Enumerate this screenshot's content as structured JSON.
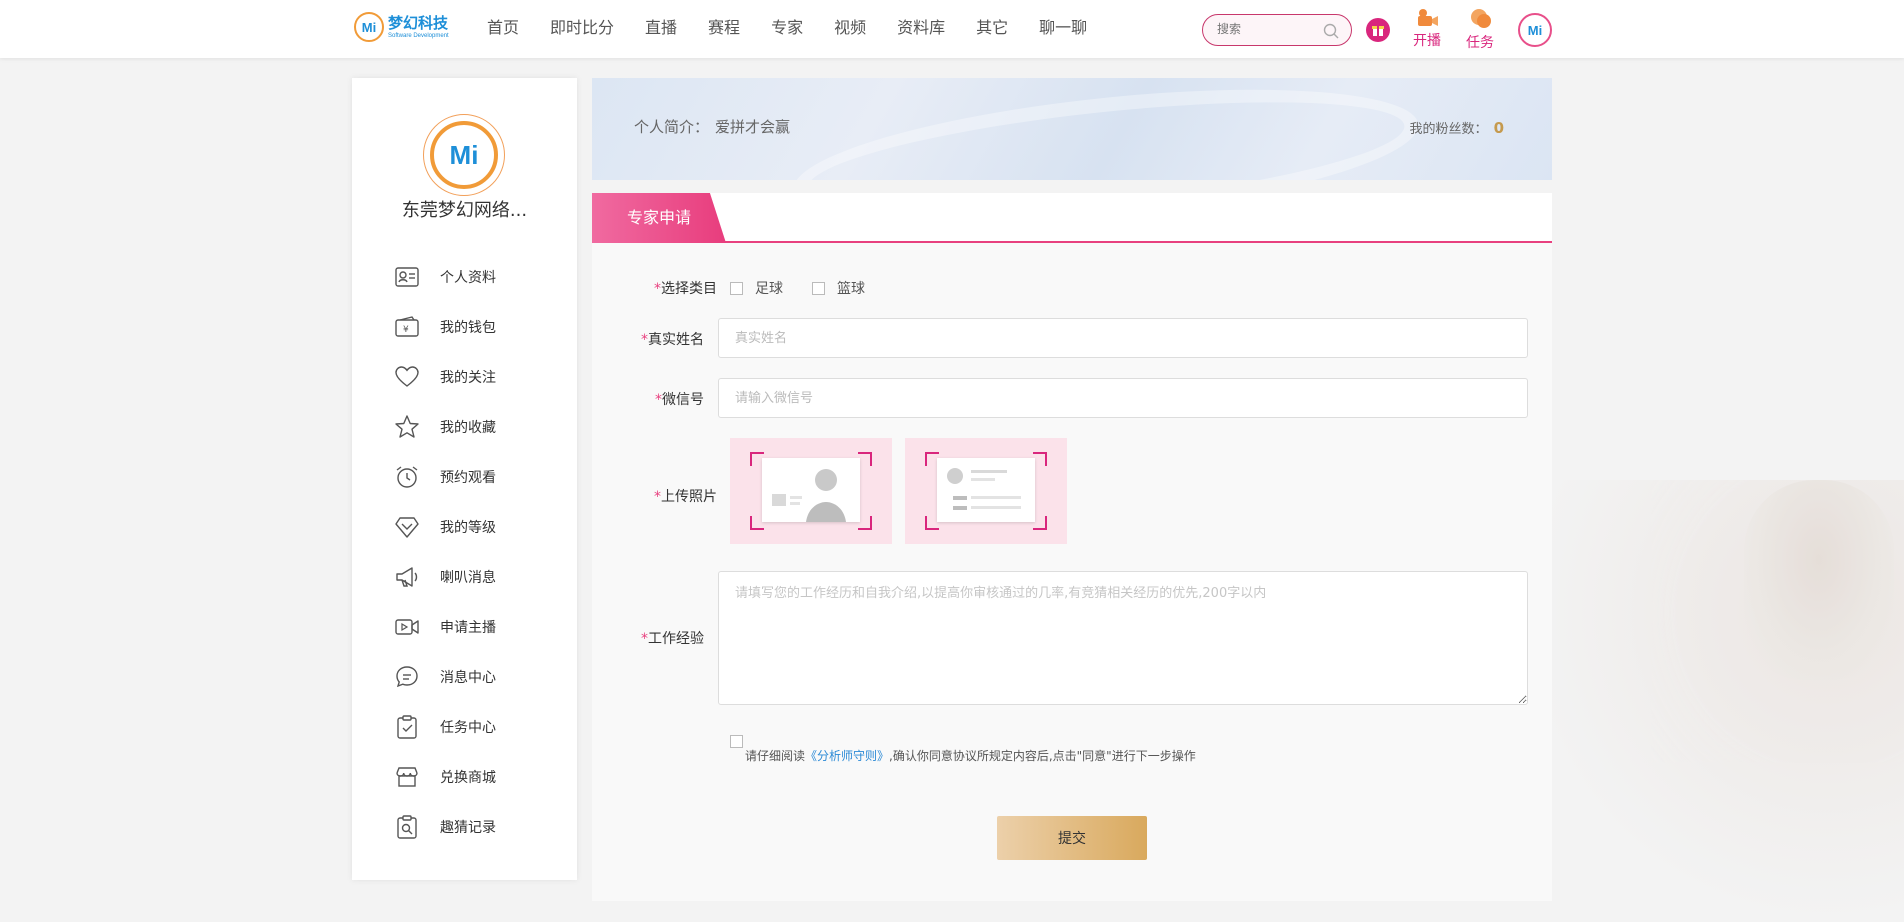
{
  "header": {
    "logo_mark": "Mi",
    "logo_name": "梦幻科技",
    "logo_sub": "Software Development",
    "nav": [
      "首页",
      "即时比分",
      "直播",
      "赛程",
      "专家",
      "视频",
      "资料库",
      "其它",
      "聊一聊"
    ],
    "search_placeholder": "搜索",
    "live_label": "开播",
    "task_label": "任务",
    "avatar_mark": "Mi"
  },
  "sidebar": {
    "avatar_mark": "Mi",
    "name": "东莞梦幻网络...",
    "items": [
      {
        "label": "个人资料",
        "icon": "id-card-icon"
      },
      {
        "label": "我的钱包",
        "icon": "wallet-icon"
      },
      {
        "label": "我的关注",
        "icon": "heart-icon"
      },
      {
        "label": "我的收藏",
        "icon": "star-icon"
      },
      {
        "label": "预约观看",
        "icon": "alarm-clock-icon"
      },
      {
        "label": "我的等级",
        "icon": "diamond-icon"
      },
      {
        "label": "喇叭消息",
        "icon": "megaphone-icon"
      },
      {
        "label": "申请主播",
        "icon": "video-camera-icon"
      },
      {
        "label": "消息中心",
        "icon": "chat-bubble-icon"
      },
      {
        "label": "任务中心",
        "icon": "clipboard-check-icon"
      },
      {
        "label": "兑换商城",
        "icon": "store-icon"
      },
      {
        "label": "趣猜记录",
        "icon": "search-record-icon"
      }
    ]
  },
  "profile": {
    "intro_label": "个人简介：",
    "intro_value": "爱拼才会赢",
    "fans_label": "我的粉丝数：",
    "fans_value": "0"
  },
  "form": {
    "tab": "专家申请",
    "required_mark": "*",
    "category_label": "选择类目",
    "category_options": [
      "足球",
      "篮球"
    ],
    "realname_label": "真实姓名",
    "realname_placeholder": "真实姓名",
    "wechat_label": "微信号",
    "wechat_placeholder": "请输入微信号",
    "photo_label": "上传照片",
    "experience_label": "工作经验",
    "experience_placeholder": "请填写您的工作经历和自我介绍,以提高你审核通过的几率,有竞猜相关经历的优先,200字以内",
    "agree_prefix": "请仔细阅读",
    "agree_link": "《分析师守则》",
    "agree_suffix": ",确认你同意协议所规定内容后,点击\"同意\"进行下一步操作",
    "submit": "提交"
  },
  "colors": {
    "accent": "#e8417f",
    "brand_blue": "#1e8fd8",
    "gold": "#d9a95d"
  }
}
